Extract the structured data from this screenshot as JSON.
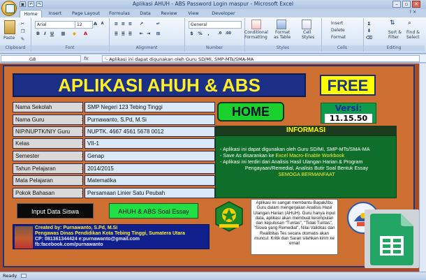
{
  "window": {
    "title": "Aplikasi AHUH - ABS Password Login maspur - Microsoft Excel"
  },
  "tabs": [
    "Home",
    "Insert",
    "Page Layout",
    "Formulas",
    "Data",
    "Review",
    "View",
    "Developer"
  ],
  "ribbon": {
    "clipboard": {
      "paste": "Paste",
      "label": "Clipboard"
    },
    "font": {
      "name": "Arial",
      "size": "12",
      "label": "Font"
    },
    "alignment": {
      "label": "Alignment"
    },
    "number": {
      "format": "General",
      "label": "Number"
    },
    "styles": {
      "conditional": "Conditional",
      "conditional2": "Formatting",
      "format_table": "Format",
      "format_table2": "as Table",
      "cell_styles": "Cell",
      "cell_styles2": "Styles",
      "label": "Styles"
    },
    "cells": {
      "insert": "Insert",
      "delete": "Delete",
      "format": "Format",
      "label": "Cells"
    },
    "editing": {
      "sort": "Sort &",
      "sort2": "Filter",
      "find": "Find &",
      "find2": "Select",
      "label": "Editing"
    }
  },
  "formula_bar": {
    "cell": "G8",
    "fx": "fx",
    "content": "'- Aplikasi ini dapat digunakan oleh Guru SD/MI, SMP-MTs/SMA-MA"
  },
  "sheet": {
    "title": "APLIKASI AHUH & ABS",
    "free": "FREE",
    "home": "HOME",
    "version_label": "Versi:",
    "version": "11.15.50",
    "fields": [
      {
        "label": "Nama Sekolah",
        "value": "SMP Negeri 123 Tebing Tinggi"
      },
      {
        "label": "Nama Guru",
        "value": "Purnawanto, S.Pd, M.Si"
      },
      {
        "label": "NIP/NUPTK/NIY Guru",
        "value": "NUPTK. 4667 4561 5678 0012"
      },
      {
        "label": "Kelas",
        "value": "VII-1"
      },
      {
        "label": "Semester",
        "value": "Genap"
      },
      {
        "label": "Tahun Pelajaran",
        "value": "2014/2015"
      },
      {
        "label": "Mata Pelajaran",
        "value": "Matematika"
      },
      {
        "label": "Pokok Bahasan",
        "value": "Persamaan Linier Satu Peubah"
      }
    ],
    "colon": ":",
    "info_title": "INFORMASI",
    "info_lines": [
      "- Aplikasi ini dapat digunakan oleh Guru SD/MI, SMP-MTs/SMA-MA",
      "- Save As disarankan ke Excel Macro-Enable Workbook",
      "- Aplikasi ini terdiri dari Analisis Hasil Ulangan Harian & Program",
      "Pengayaan/Remedial, Analisis Butir Soal Bentuk Essay",
      "SEMOGA BERMANFAAT"
    ],
    "save_as_prefix": "- Save As disarankan ke ",
    "save_as_highlight": "Excel Macro-Enable Workbook",
    "input_button": "Input Data Siswa",
    "essay_button": "AHUH & ABS Soal Essay",
    "credit": {
      "line1": "Created by: Purnawanto, S.Pd, M.Si",
      "line2": "Pengawas Dinas Pendidikan Kota Tebing Tinggi, Sumatera Utara",
      "line3": "CP: 081361344424 e:purnawanto@gmail.com",
      "line4": "fb:facebook.com/purnawanto"
    },
    "about": "Aplikasi ini sangat membantu Bapak/Ibu Guru dalam mengerjakan Analisis Hasil Ulangan Harian (AHUH). Guru hanya input data, aplikasi akan membuat kesimpulan dan keputusan \"Tuntas\", \"Tidak Tuntas\", \"Siswa yang Remedial\", Nilai Validitas dan Realibitas Tes secara otomatis akan muncul. Kritik dan Saran silahkan kirim ke email",
    "corner_mark": "@h"
  },
  "status": {
    "text": "Ready"
  },
  "colors": {
    "panel": "#cc6f31",
    "title_bg": "#1c2f86",
    "title_fg": "#ffee22",
    "home_btn": "#19d02d",
    "info_bg": "#0e6e2a"
  }
}
